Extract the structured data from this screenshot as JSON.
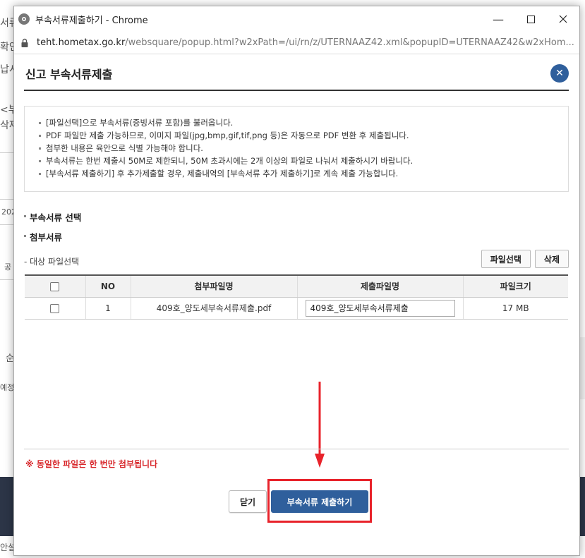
{
  "window": {
    "title": "부속서류제출하기 - Chrome",
    "url_domain": "teht.hometax.go.kr",
    "url_path": "/websquare/popup.html?w2xPath=/ui/rn/z/UTERNAAZ42.xml&popupID=UTERNAAZ42&w2xHom..."
  },
  "popup": {
    "title": "신고 부속서류제출",
    "notices": [
      "[파일선택]으로 부속서류(증빙서류 포함)를 불러옵니다.",
      "PDF 파일만 제출 가능하므로, 이미지 파일(jpg,bmp,gif,tif,png 등)은 자동으로 PDF 변환 후 제출됩니다.",
      "첨부한 내용은 육안으로 식별 가능해야 합니다.",
      "부속서류는 한번 제출시 50M로 제한되니, 50M 초과시에는 2개 이상의 파일로 나눠서 제출하시기 바랍니다.",
      "[부속서류 제출하기] 후 추가제출할 경우, 제출내역의 [부속서류 추가 제출하기]로 계속 제출 가능합니다."
    ],
    "section_select": "부속서류 선택",
    "section_attach": "첨부서류",
    "target_label": "- 대상 파일선택",
    "btn_select_file": "파일선택",
    "btn_delete": "삭제",
    "table": {
      "headers": [
        "NO",
        "첨부파일명",
        "제출파일명",
        "파일크기"
      ],
      "rows": [
        {
          "no": "1",
          "attach_name": "409호_양도세부속서류제출.pdf",
          "submit_name": "409호_양도세부속서류제출",
          "size": "17 MB"
        }
      ]
    },
    "warning": "※ 동일한 파일은 한 번만 첨부됩니다",
    "btn_close": "닫기",
    "btn_submit": "부속서류 제출하기"
  },
  "colors": {
    "primary": "#2f5f9c",
    "warning": "#d8282c",
    "highlight": "#e8232b"
  }
}
